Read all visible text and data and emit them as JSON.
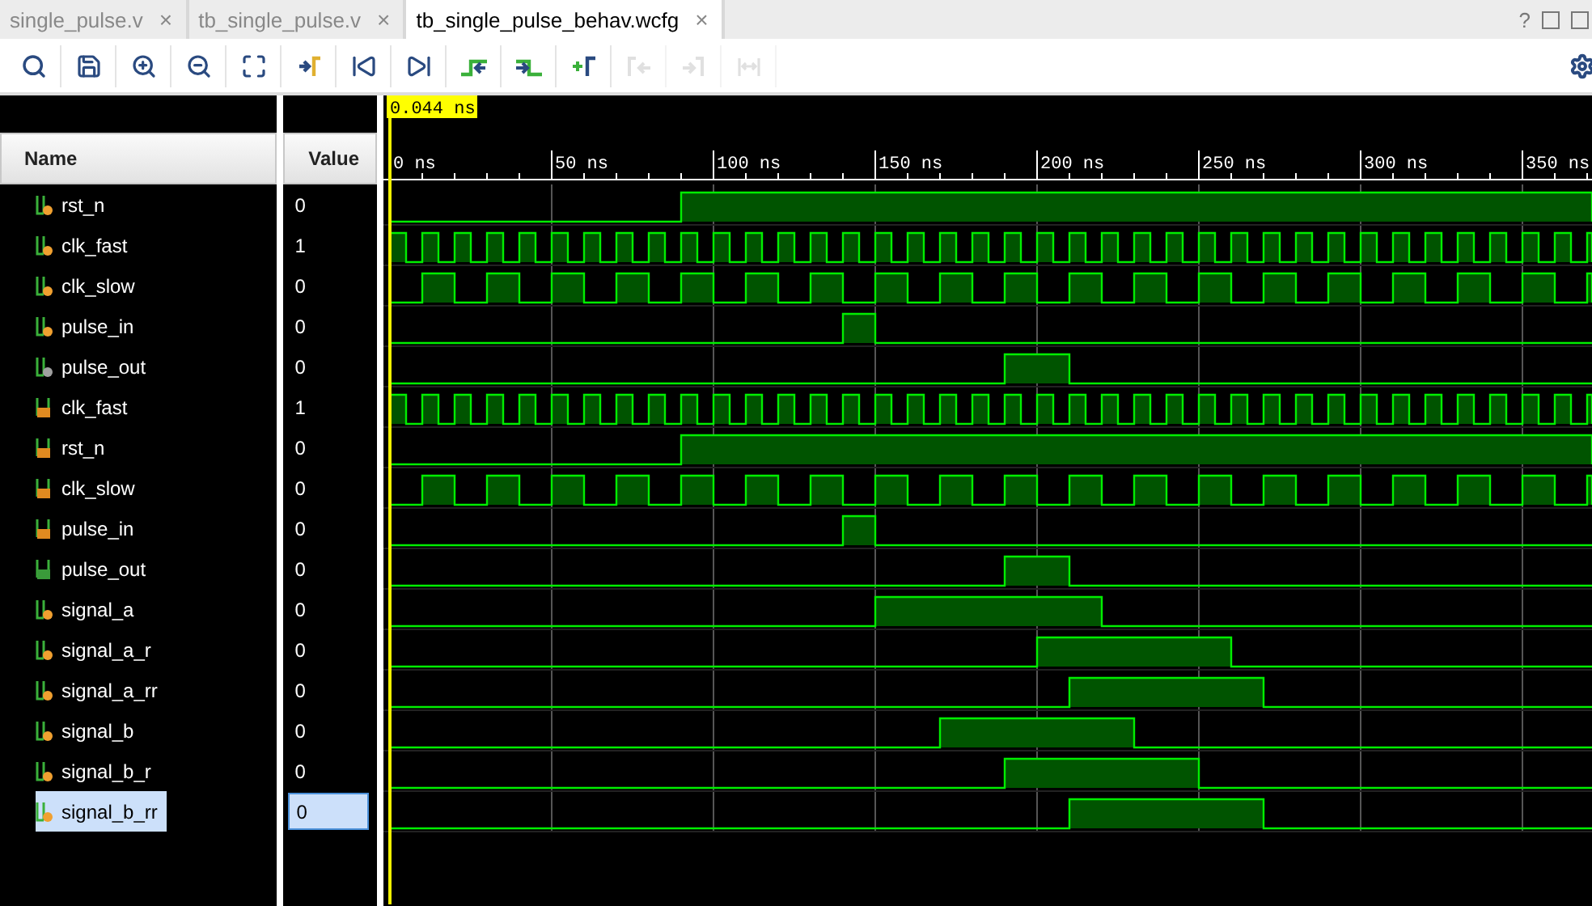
{
  "tabs": [
    {
      "label": "single_pulse.v",
      "close": "×",
      "selected": false
    },
    {
      "label": "tb_single_pulse.v",
      "close": "×",
      "selected": false
    },
    {
      "label": "tb_single_pulse_behav.wcfg",
      "close": "×",
      "selected": true
    }
  ],
  "window_controls": [
    "?"
  ],
  "toolbar": [
    {
      "kind": "search",
      "disabled": false
    },
    {
      "kind": "save",
      "disabled": false
    },
    {
      "kind": "zoomin",
      "disabled": false
    },
    {
      "kind": "zoomout",
      "disabled": false
    },
    {
      "kind": "fit",
      "disabled": false
    },
    {
      "kind": "cursor",
      "disabled": false
    },
    {
      "kind": "start",
      "disabled": false
    },
    {
      "kind": "end",
      "disabled": false
    },
    {
      "kind": "prevedge",
      "disabled": false
    },
    {
      "kind": "nextedge",
      "disabled": false
    },
    {
      "kind": "addmarker",
      "disabled": false
    },
    {
      "kind": "prevmarker",
      "disabled": true
    },
    {
      "kind": "nextmarker",
      "disabled": true
    },
    {
      "kind": "swap",
      "disabled": true
    }
  ],
  "columns": {
    "name": "Name",
    "value": "Value"
  },
  "cursor": {
    "label": "0.044 ns"
  },
  "ticks": [
    "0 ns",
    "50 ns",
    "100 ns",
    "150 ns",
    "200 ns",
    "250 ns",
    "300 ns",
    "350 ns"
  ],
  "signals": [
    {
      "name": "rst_n",
      "value": "0",
      "kind": "wire",
      "color": "#f0a030",
      "selected": false
    },
    {
      "name": "clk_fast",
      "value": "1",
      "kind": "wire",
      "color": "#f0a030",
      "selected": false
    },
    {
      "name": "clk_slow",
      "value": "0",
      "kind": "wire",
      "color": "#f0a030",
      "selected": false
    },
    {
      "name": "pulse_in",
      "value": "0",
      "kind": "wire",
      "color": "#f0a030",
      "selected": false
    },
    {
      "name": "pulse_out",
      "value": "0",
      "kind": "wire",
      "color": "#a0a0a0",
      "selected": false
    },
    {
      "name": "clk_fast",
      "value": "1",
      "kind": "port",
      "color": "#e08a20",
      "selected": false
    },
    {
      "name": "rst_n",
      "value": "0",
      "kind": "port",
      "color": "#e08a20",
      "selected": false
    },
    {
      "name": "clk_slow",
      "value": "0",
      "kind": "port",
      "color": "#e08a20",
      "selected": false
    },
    {
      "name": "pulse_in",
      "value": "0",
      "kind": "port",
      "color": "#e08a20",
      "selected": false
    },
    {
      "name": "pulse_out",
      "value": "0",
      "kind": "port",
      "color": "#3a9a3a",
      "selected": false
    },
    {
      "name": "signal_a",
      "value": "0",
      "kind": "wire",
      "color": "#f0a030",
      "selected": false
    },
    {
      "name": "signal_a_r",
      "value": "0",
      "kind": "wire",
      "color": "#f0a030",
      "selected": false
    },
    {
      "name": "signal_a_rr",
      "value": "0",
      "kind": "wire",
      "color": "#f0a030",
      "selected": false
    },
    {
      "name": "signal_b",
      "value": "0",
      "kind": "wire",
      "color": "#f0a030",
      "selected": false
    },
    {
      "name": "signal_b_r",
      "value": "0",
      "kind": "wire",
      "color": "#f0a030",
      "selected": false
    },
    {
      "name": "signal_b_rr",
      "value": "0",
      "kind": "wire",
      "color": "#f0a030",
      "selected": true
    }
  ]
}
